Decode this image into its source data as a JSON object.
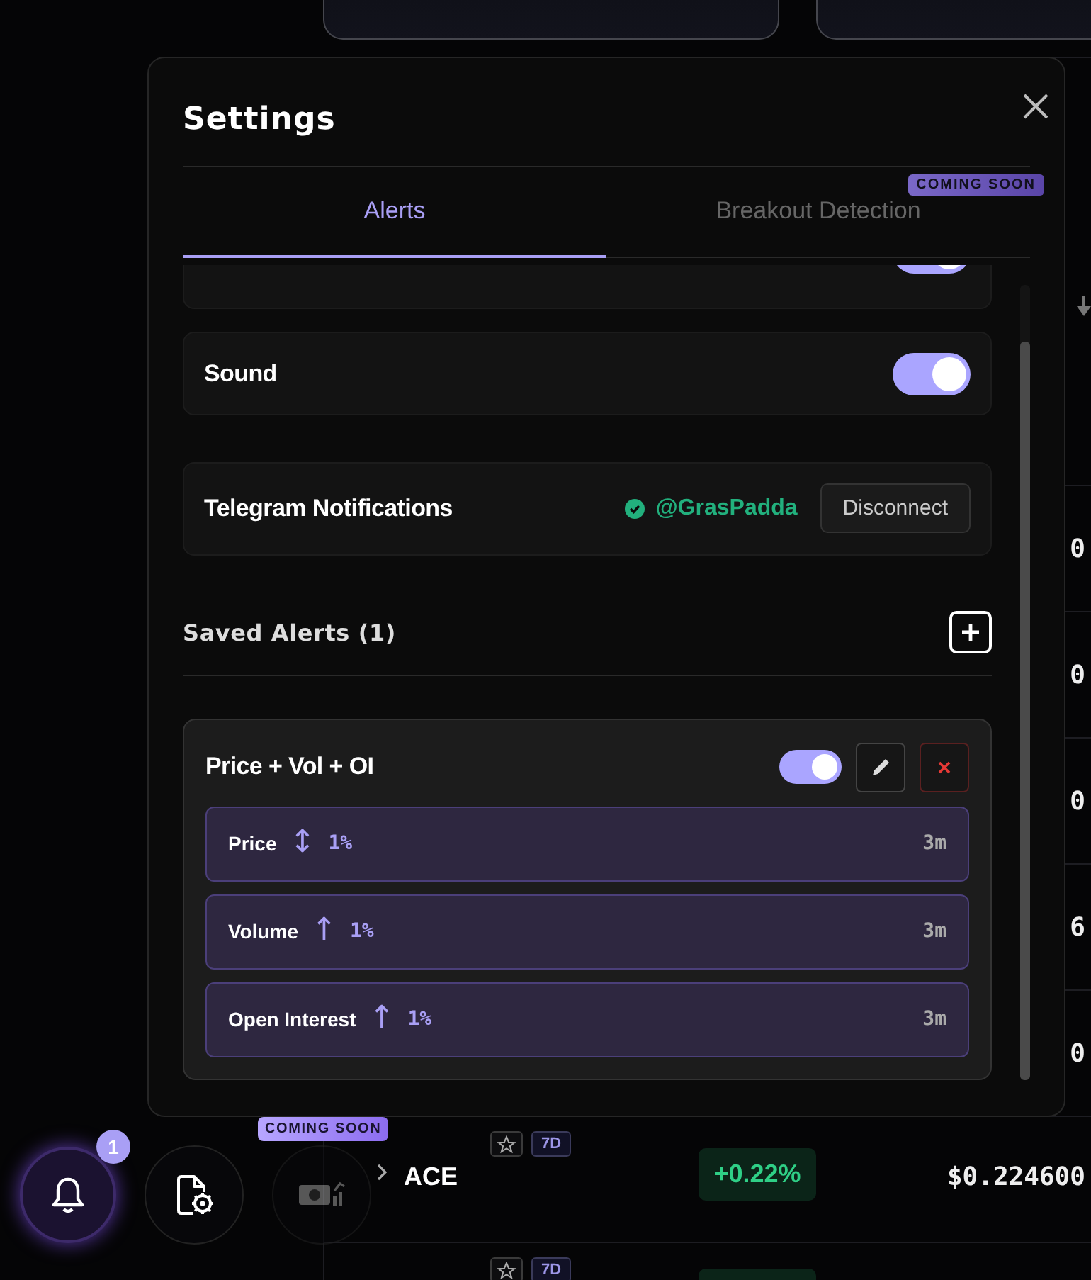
{
  "background": {
    "value_rows": [
      {
        "value": "0"
      },
      {
        "value": "0"
      },
      {
        "value": "0"
      },
      {
        "value": "6"
      },
      {
        "value": "0"
      }
    ],
    "ticker_rows": [
      {
        "symbol": "ACE",
        "timeframe": "7D",
        "change": "+0.22%",
        "price": "$0.224600"
      },
      {
        "timeframe": "7D"
      }
    ]
  },
  "dock": {
    "buttons": [
      {
        "kind": "alerts",
        "badge": "1",
        "selected": true,
        "disabled": false
      },
      {
        "kind": "settings",
        "selected": false,
        "disabled": false
      },
      {
        "kind": "money",
        "tag": "COMING SOON",
        "selected": false,
        "disabled": true
      }
    ]
  },
  "dialog": {
    "title": "Settings",
    "tabs": [
      {
        "label": "Alerts",
        "selected": true
      },
      {
        "label": "Breakout Detection",
        "selected": false,
        "tag": "COMING SOON"
      }
    ],
    "settings": [
      {
        "kind": "partial",
        "on": true
      },
      {
        "kind": "toggle",
        "label": "Sound",
        "on": true
      },
      {
        "kind": "telegram",
        "label": "Telegram Notifications",
        "connected": true,
        "handle": "@GrasPadda",
        "action": "Disconnect"
      }
    ],
    "saved_alerts": {
      "title": "Saved Alerts (1)",
      "alerts": [
        {
          "name": "Price + Vol + OI",
          "on": true,
          "conditions": [
            {
              "metric": "Price",
              "arrow": "↕",
              "threshold": "1%",
              "interval": "3m"
            },
            {
              "metric": "Volume",
              "arrow": "↑",
              "threshold": "1%",
              "interval": "3m"
            },
            {
              "metric": "Open Interest",
              "arrow": "↑",
              "threshold": "1%",
              "interval": "3m"
            }
          ]
        }
      ]
    }
  }
}
